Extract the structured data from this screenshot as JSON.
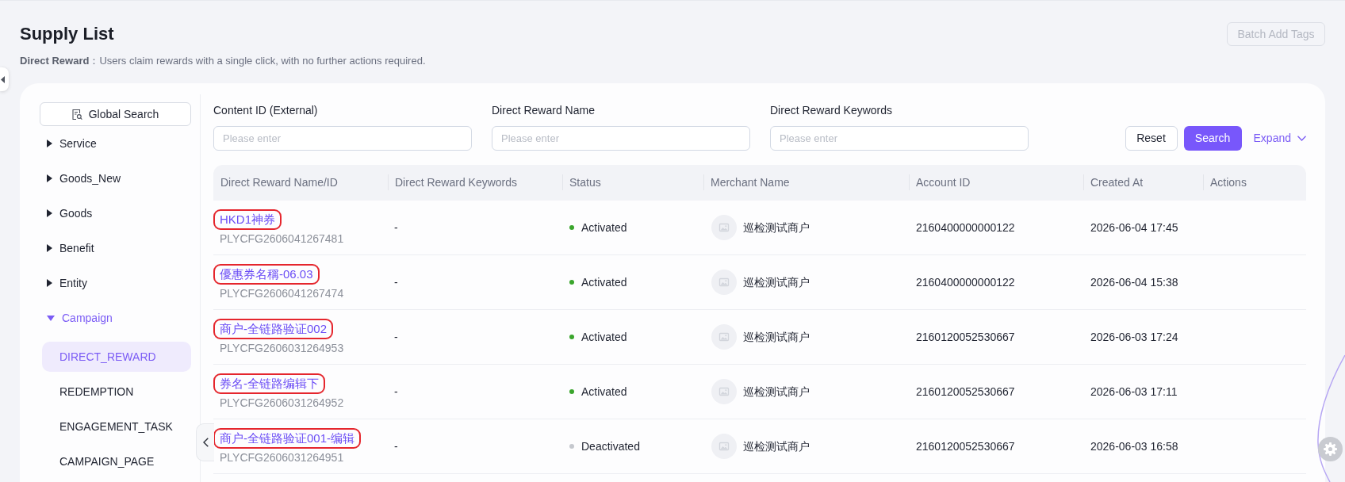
{
  "page": {
    "title": "Supply List",
    "description": "**Direct Reward**：Users claim rewards with a single click, with no further actions required."
  },
  "toolbar": {
    "batch_add_tags": {
      "label": "Batch Add Tags",
      "disabled": true
    }
  },
  "sidebar": {
    "global_search": {
      "label": "Global Search"
    },
    "items": [
      {
        "label": "Service",
        "expanded": false
      },
      {
        "label": "Goods_New",
        "expanded": false
      },
      {
        "label": "Goods",
        "expanded": false
      },
      {
        "label": "Benefit",
        "expanded": false
      },
      {
        "label": "Entity",
        "expanded": false
      },
      {
        "label": "Campaign",
        "expanded": true,
        "children": [
          {
            "label": "DIRECT_REWARD",
            "selected": true
          },
          {
            "label": "REDEMPTION",
            "selected": false
          },
          {
            "label": "ENGAGEMENT_TASK",
            "selected": false
          },
          {
            "label": "CAMPAIGN_PAGE",
            "selected": false
          }
        ]
      }
    ]
  },
  "filters": {
    "fields": [
      {
        "label": "Content ID (External)",
        "placeholder": "Please enter"
      },
      {
        "label": "Direct Reward Name",
        "placeholder": "Please enter"
      },
      {
        "label": "Direct Reward Keywords",
        "placeholder": "Please enter"
      }
    ],
    "reset": {
      "label": "Reset"
    },
    "search": {
      "label": "Search"
    },
    "expand": {
      "label": "Expand"
    }
  },
  "table": {
    "columns": [
      "Direct Reward Name/ID",
      "Direct Reward Keywords",
      "Status",
      "Merchant Name",
      "Account ID",
      "Created At",
      "Actions"
    ],
    "rows": [
      {
        "name": "HKD1神券",
        "circled": true,
        "id": "PLYCFG2606041267481",
        "keywords": "-",
        "status": {
          "label": "Activated",
          "color": "#3aa52c"
        },
        "merchant": "巡检测试商户",
        "account_id": "2160400000000122",
        "created_at": "2026-06-04 17:45"
      },
      {
        "name": "優惠券名稱-06.03",
        "circled": true,
        "id": "PLYCFG2606041267474",
        "keywords": "-",
        "status": {
          "label": "Activated",
          "color": "#3aa52c"
        },
        "merchant": "巡检测试商户",
        "account_id": "2160400000000122",
        "created_at": "2026-06-04 15:38"
      },
      {
        "name": "商户-全链路验证002",
        "circled": true,
        "id": "PLYCFG2606031264953",
        "keywords": "-",
        "status": {
          "label": "Activated",
          "color": "#3aa52c"
        },
        "merchant": "巡检测试商户",
        "account_id": "2160120052530667",
        "created_at": "2026-06-03 17:24"
      },
      {
        "name": "券名-全链路编辑下",
        "circled": true,
        "id": "PLYCFG2606031264952",
        "keywords": "-",
        "status": {
          "label": "Activated",
          "color": "#3aa52c"
        },
        "merchant": "巡检测试商户",
        "account_id": "2160120052530667",
        "created_at": "2026-06-03 17:11"
      },
      {
        "name": "商户-全链路验证001-编辑",
        "circled": true,
        "id": "PLYCFG2606031264951",
        "keywords": "-",
        "status": {
          "label": "Deactivated",
          "color": "#c5c8ce"
        },
        "merchant": "巡检测试商户",
        "account_id": "2160120052530667",
        "created_at": "2026-06-03 16:58"
      }
    ]
  }
}
